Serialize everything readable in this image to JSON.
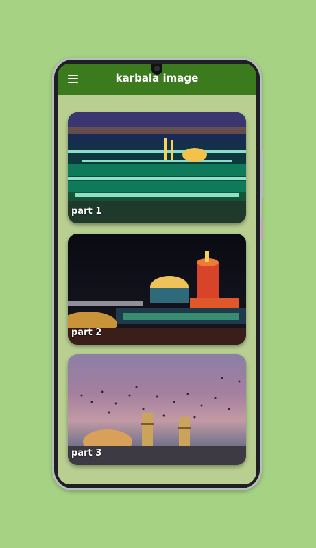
{
  "app": {
    "title": "karbala image"
  },
  "cards": [
    {
      "label": "part 1"
    },
    {
      "label": "part 2"
    },
    {
      "label": "part 3"
    }
  ]
}
